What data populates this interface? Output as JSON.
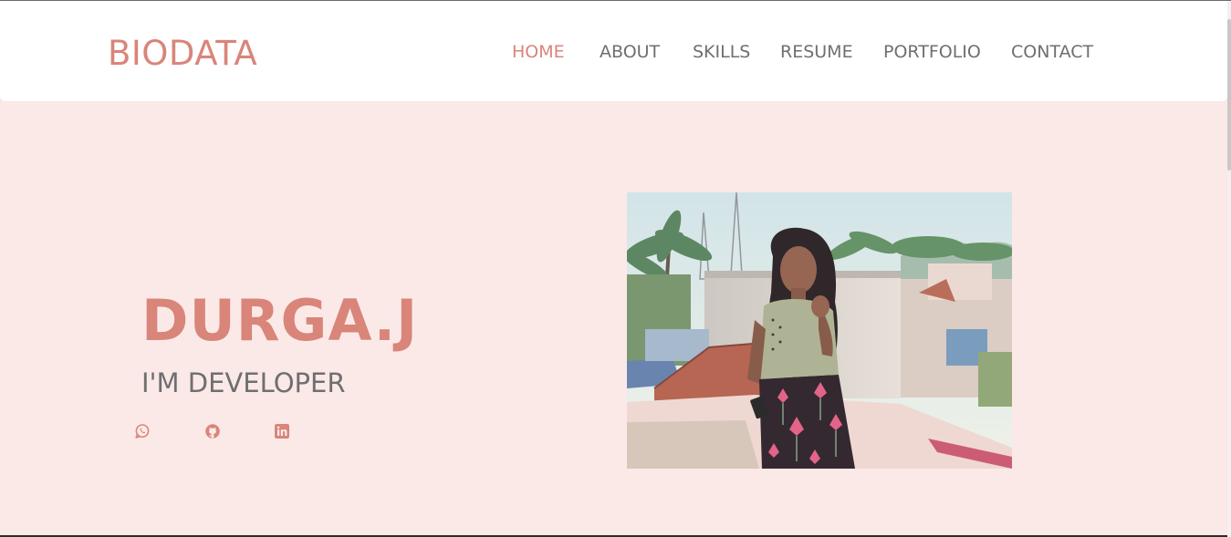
{
  "brand": "BIODATA",
  "nav": [
    {
      "label": "HOME",
      "active": true
    },
    {
      "label": "ABOUT",
      "active": false
    },
    {
      "label": "SKILLS",
      "active": false
    },
    {
      "label": "RESUME",
      "active": false
    },
    {
      "label": "PORTFOLIO",
      "active": false
    },
    {
      "label": "CONTACT",
      "active": false
    }
  ],
  "hero": {
    "name": "DURGA.J",
    "role": "I'M DEVELOPER",
    "socials": [
      "whatsapp-icon",
      "github-icon",
      "linkedin-icon"
    ]
  },
  "colors": {
    "accent": "#d9857a",
    "background": "#fbe9e8",
    "text": "#6f6f6f",
    "navbar": "#ffffff"
  }
}
